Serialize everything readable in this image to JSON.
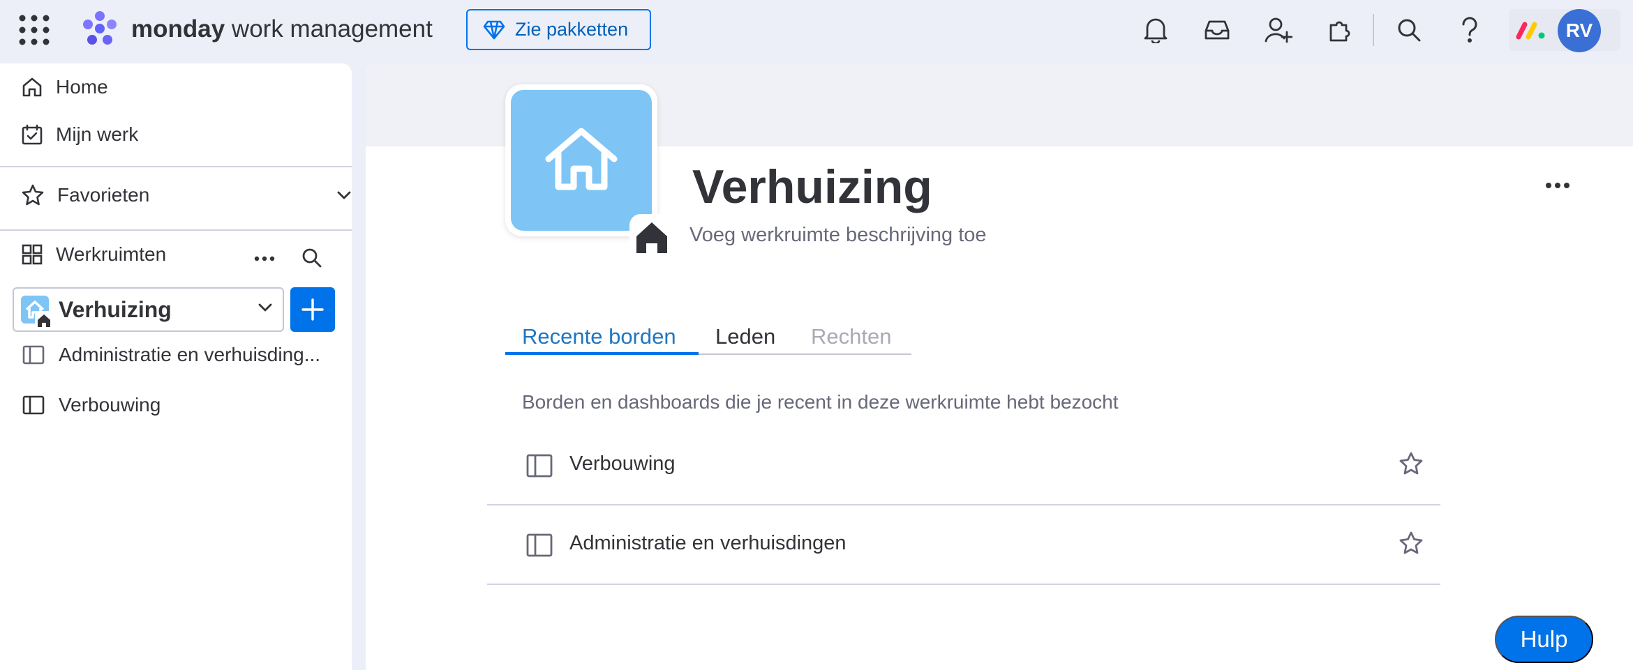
{
  "topbar": {
    "brand_bold": "monday",
    "brand_light": " work management",
    "upgrade_label": "Zie pakketten",
    "avatar_initials": "RV",
    "icons": [
      "apps-grid-icon",
      "notifications-bell-icon",
      "inbox-icon",
      "invite-members-icon",
      "apps-marketplace-icon",
      "search-icon",
      "help-icon"
    ]
  },
  "sidebar": {
    "home_label": "Home",
    "my_work_label": "Mijn werk",
    "favorites_label": "Favorieten",
    "workspaces_label": "Werkruimten",
    "selected_workspace": "Verhuizing",
    "boards": [
      {
        "label": "Administratie en verhuisding..."
      },
      {
        "label": "Verbouwing"
      }
    ]
  },
  "main": {
    "title": "Verhuizing",
    "description_placeholder": "Voeg werkruimte beschrijving toe",
    "tabs": [
      {
        "label": "Recente borden"
      },
      {
        "label": "Leden"
      },
      {
        "label": "Rechten"
      }
    ],
    "recent_desc": "Borden en dashboards die je recent in deze werkruimte hebt bezocht",
    "recent_boards": [
      {
        "label": "Verbouwing"
      },
      {
        "label": "Administratie en verhuisdingen"
      }
    ]
  },
  "help_label": "Hulp",
  "colors": {
    "accent": "#0073ea",
    "workspace_avatar": "#7ec5f6",
    "background": "#eceff8",
    "avatar": "#3a6fd6"
  }
}
